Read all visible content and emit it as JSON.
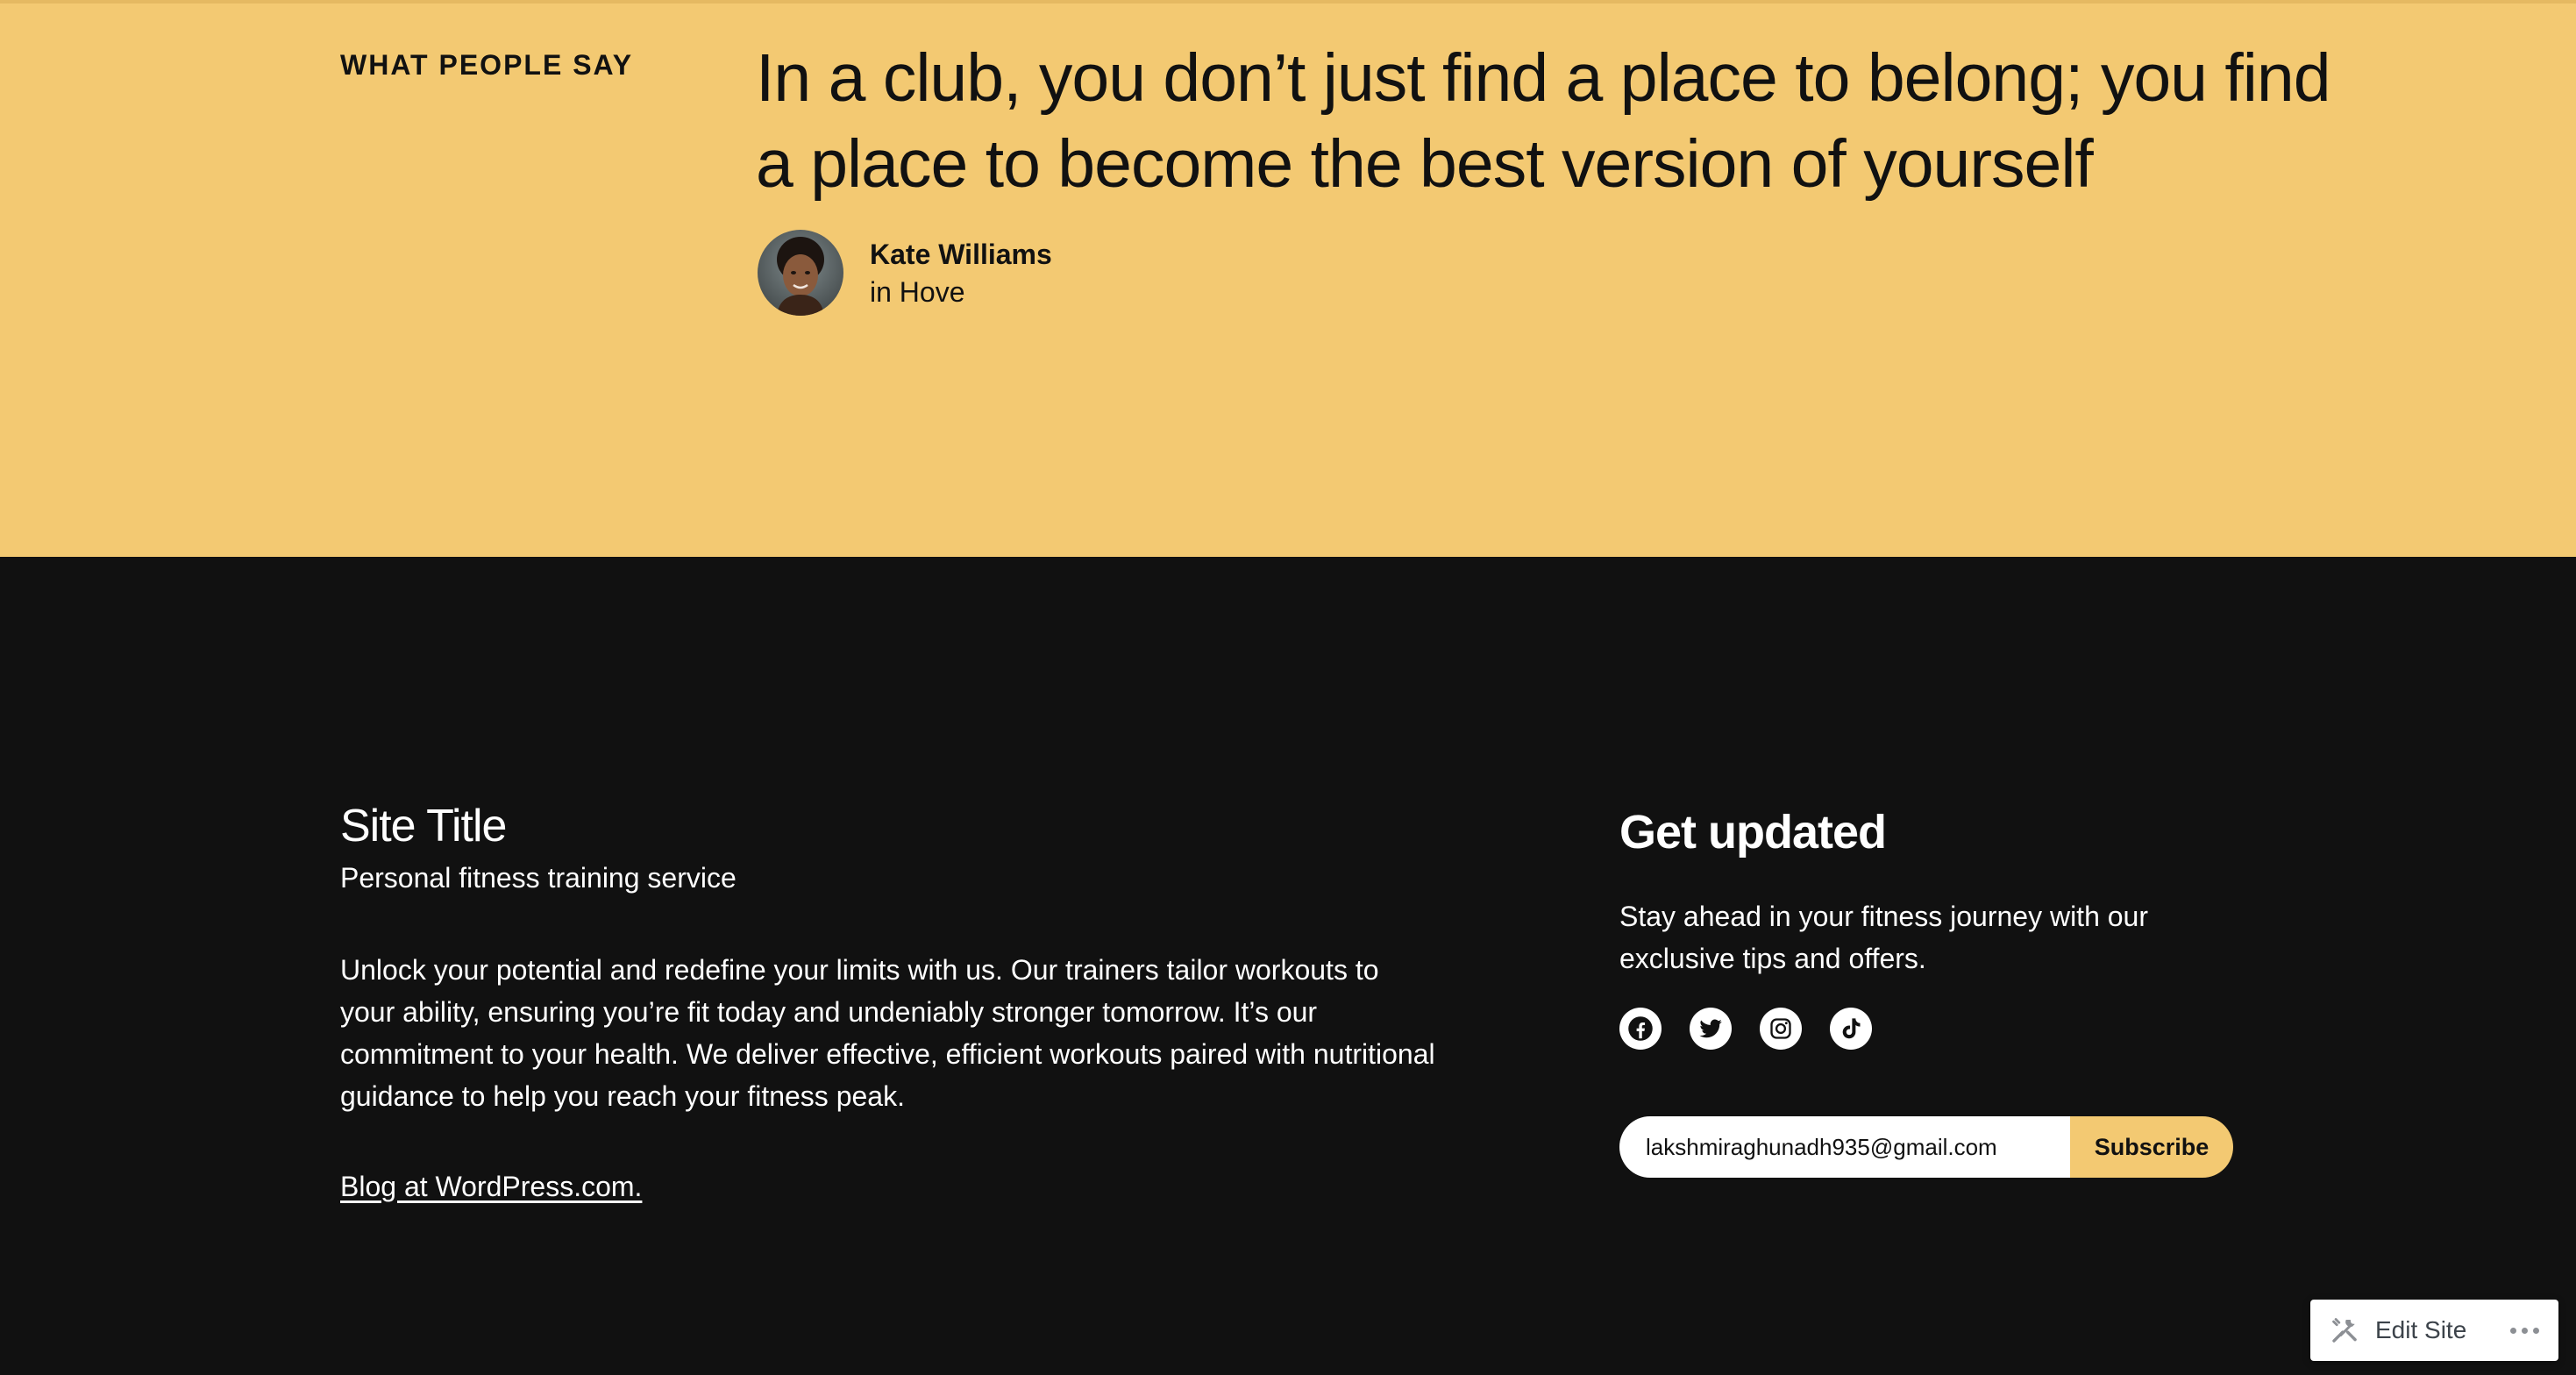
{
  "testimonial": {
    "eyebrow": "WHAT PEOPLE SAY",
    "quote": "In a club, you don’t just find a place to belong; you find a place to become the best version of yourself",
    "author_name": "Kate Williams",
    "author_location": "in Hove",
    "avatar_icon": "person-photo"
  },
  "footer": {
    "site_title": "Site Title",
    "tagline": "Personal fitness training service",
    "about": "Unlock your potential and redefine your limits with us. Our trainers tailor workouts to your ability, ensuring you’re fit today and undeniably stronger tomorrow. It’s our commitment to your health. We deliver effective, efficient workouts paired with nutritional guidance to help you reach your fitness peak.",
    "credit_link": "Blog at WordPress.com.",
    "newsletter": {
      "title": "Get updated",
      "description": "Stay ahead in your fitness journey with our exclusive tips and offers.",
      "email_value": "lakshmiraghunadh935@gmail.com",
      "subscribe_label": "Subscribe"
    },
    "socials": [
      {
        "icon": "facebook-icon"
      },
      {
        "icon": "twitter-icon"
      },
      {
        "icon": "instagram-icon"
      },
      {
        "icon": "tiktok-icon"
      }
    ]
  },
  "edit_bar": {
    "label": "Edit Site",
    "icon": "tools-icon",
    "more_icon": "ellipsis-icon"
  },
  "colors": {
    "accent_yellow": "#f3c972",
    "footer_bg": "#111111",
    "text_dark": "#111111",
    "text_light": "#ffffff"
  }
}
